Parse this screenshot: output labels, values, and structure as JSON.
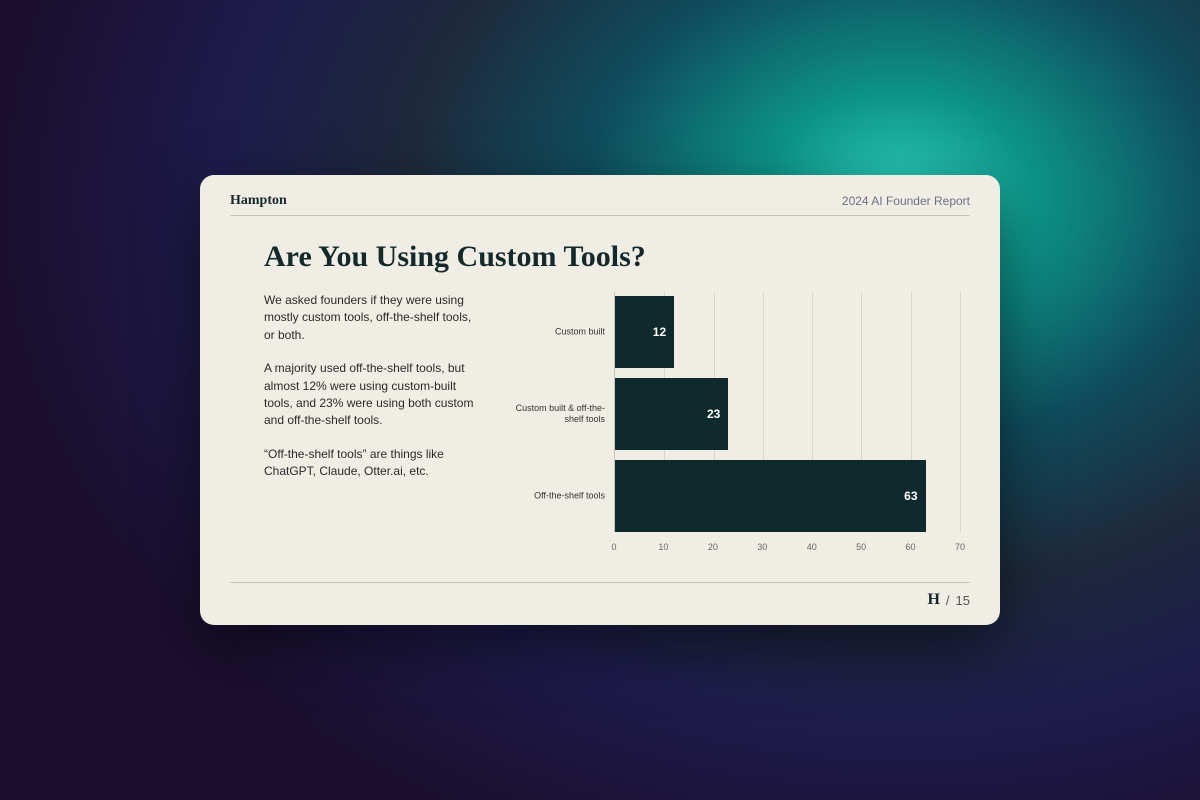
{
  "header": {
    "brand": "Hampton",
    "report": "2024 AI Founder Report"
  },
  "title": "Are You Using Custom Tools?",
  "paragraphs": [
    "We asked founders if they were using mostly custom tools, off-the-shelf tools, or both.",
    "A majority used off-the-shelf tools, but almost 12% were using custom-built tools, and 23% were using both custom and off-the-shelf tools.",
    "“Off-the-shelf tools” are things like ChatGPT, Claude, Otter.ai, etc."
  ],
  "footer": {
    "logo": "H",
    "separator": "/",
    "page": "15"
  },
  "chart_data": {
    "type": "bar",
    "orientation": "horizontal",
    "categories": [
      "Custom built",
      "Custom built & off-the-shelf tools",
      "Off-the-shelf tools"
    ],
    "values": [
      12,
      23,
      63
    ],
    "xlabel": "",
    "ylabel": "",
    "xlim": [
      0,
      70
    ],
    "ticks": [
      0,
      10,
      20,
      30,
      40,
      50,
      60,
      70
    ],
    "bar_color": "#0f2a2c"
  }
}
